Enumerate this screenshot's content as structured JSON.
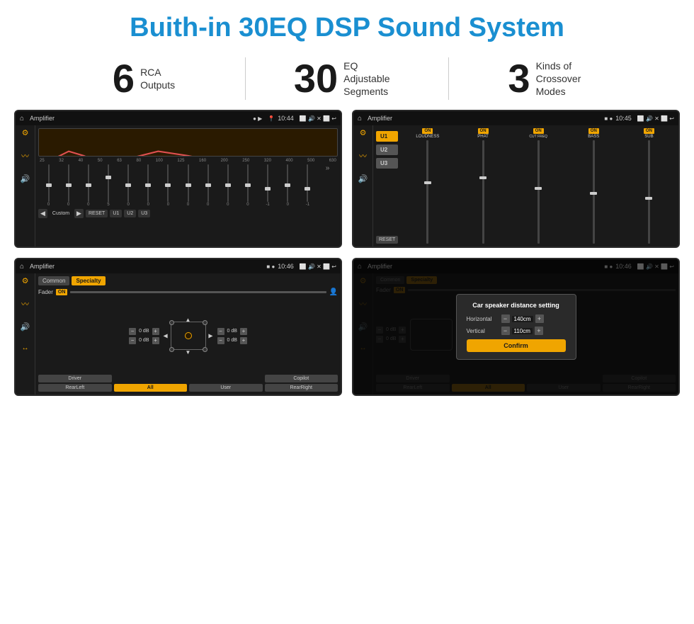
{
  "title": "Buith-in 30EQ DSP Sound System",
  "stats": [
    {
      "number": "6",
      "label": "RCA\nOutputs"
    },
    {
      "number": "30",
      "label": "EQ Adjustable\nSegments"
    },
    {
      "number": "3",
      "label": "Kinds of\nCrossover Modes"
    }
  ],
  "screens": [
    {
      "id": "eq-screen",
      "statusBar": {
        "title": "Amplifier",
        "time": "10:44"
      },
      "type": "eq"
    },
    {
      "id": "crossover-screen",
      "statusBar": {
        "title": "Amplifier",
        "time": "10:45"
      },
      "type": "crossover"
    },
    {
      "id": "specialty-screen",
      "statusBar": {
        "title": "Amplifier",
        "time": "10:46"
      },
      "type": "specialty"
    },
    {
      "id": "dialog-screen",
      "statusBar": {
        "title": "Amplifier",
        "time": "10:46"
      },
      "type": "dialog"
    }
  ],
  "eq": {
    "freqLabels": [
      "25",
      "32",
      "40",
      "50",
      "63",
      "80",
      "100",
      "125",
      "160",
      "200",
      "250",
      "320",
      "400",
      "500",
      "630"
    ],
    "sliderValues": [
      "0",
      "0",
      "0",
      "5",
      "0",
      "0",
      "0",
      "0",
      "0",
      "0",
      "0",
      "-1",
      "0",
      "-1"
    ],
    "presets": [
      "Custom",
      "RESET",
      "U1",
      "U2",
      "U3"
    ]
  },
  "crossover": {
    "uButtons": [
      "U1",
      "U2",
      "U3"
    ],
    "controls": [
      {
        "label": "LOUDNESS",
        "on": true
      },
      {
        "label": "PHAT",
        "on": true
      },
      {
        "label": "CUT FREQ",
        "on": true
      },
      {
        "label": "BASS",
        "on": true
      },
      {
        "label": "SUB",
        "on": true
      }
    ],
    "resetLabel": "RESET"
  },
  "specialty": {
    "tabs": [
      "Common",
      "Specialty"
    ],
    "faderLabel": "Fader",
    "onLabel": "ON",
    "dbValues": [
      "0 dB",
      "0 dB",
      "0 dB",
      "0 dB"
    ],
    "buttons": [
      "Driver",
      "",
      "",
      "Copilot",
      "RearLeft",
      "All",
      "User",
      "RearRight"
    ]
  },
  "dialog": {
    "title": "Car speaker distance setting",
    "horizontal": {
      "label": "Horizontal",
      "value": "140cm"
    },
    "vertical": {
      "label": "Vertical",
      "value": "110cm"
    },
    "confirmLabel": "Confirm"
  },
  "colors": {
    "accent": "#1a8fd1",
    "orange": "#f0a500",
    "dark": "#1a1a1a",
    "text": "#333333"
  }
}
